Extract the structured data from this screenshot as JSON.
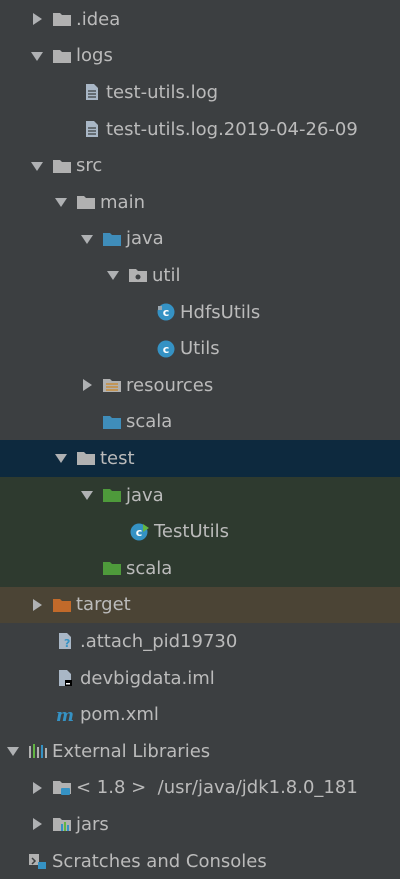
{
  "tree": {
    "rows": [
      {
        "label": ".idea"
      },
      {
        "label": "logs"
      },
      {
        "label": "test-utils.log"
      },
      {
        "label": "test-utils.log.2019-04-26-09"
      },
      {
        "label": "src"
      },
      {
        "label": "main"
      },
      {
        "label": "java"
      },
      {
        "label": "util"
      },
      {
        "label": "HdfsUtils"
      },
      {
        "label": "Utils"
      },
      {
        "label": "resources"
      },
      {
        "label": "scala"
      },
      {
        "label": "test"
      },
      {
        "label": "java"
      },
      {
        "label": "TestUtils"
      },
      {
        "label": "scala"
      },
      {
        "label": "target"
      },
      {
        "label": ".attach_pid19730"
      },
      {
        "label": "devbigdata.iml"
      },
      {
        "label": "pom.xml"
      },
      {
        "label": "External Libraries"
      },
      {
        "label": "< 1.8 >  /usr/java/jdk1.8.0_181"
      },
      {
        "label": "jars"
      },
      {
        "label": "Scratches and Consoles"
      }
    ]
  },
  "colors": {
    "background": "#3c3f41",
    "selected_row": "#0d293e",
    "test_row": "#2e3a2f",
    "excluded_row": "#4b4435",
    "folder_grey": "#b1b1b1",
    "folder_blue": "#3f8dba",
    "folder_green": "#4e9a3b",
    "folder_orange": "#c26a2a",
    "class_icon": "#3592c4"
  }
}
